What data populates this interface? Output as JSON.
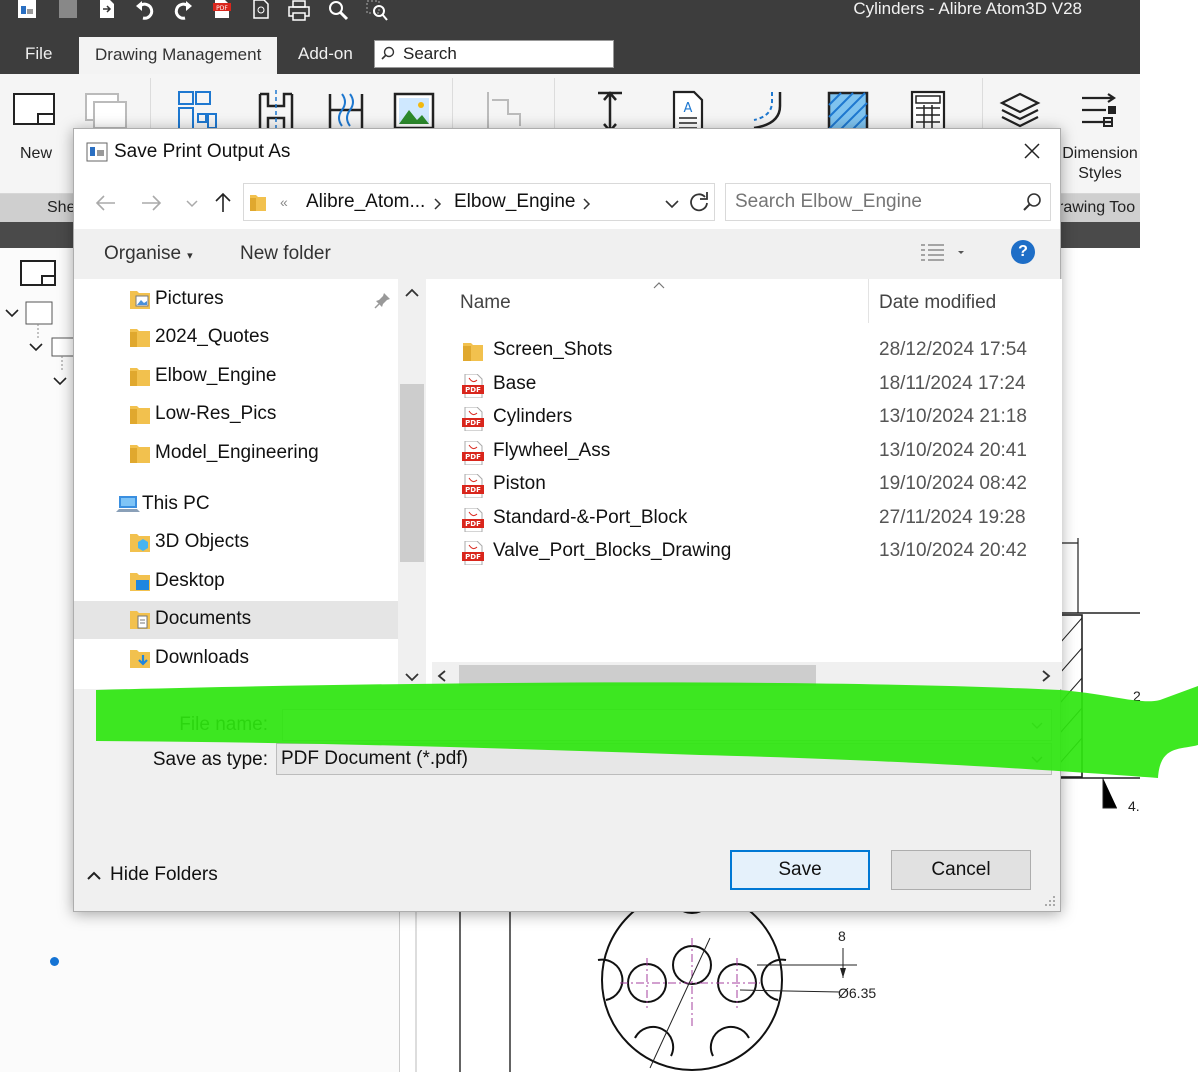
{
  "app": {
    "title": "Cylinders - Alibre Atom3D V28",
    "menu": [
      "File",
      "Drawing Management",
      "Add-on"
    ],
    "search_label": "Search",
    "ribbon": {
      "new_label": "New",
      "dimension_styles_label": "Dimension Styles",
      "strip_left": "She",
      "strip_right": "rawing Too"
    }
  },
  "drawing": {
    "dim_8": "8",
    "dim_dia": "Ø6.35",
    "dim_4": "4.",
    "dim_2": "2"
  },
  "dialog": {
    "title": "Save Print Output As",
    "breadcrumb": [
      "Alibre_Atom...",
      "Elbow_Engine"
    ],
    "search_placeholder": "Search Elbow_Engine",
    "toolbar": {
      "organise": "Organise",
      "new_folder": "New folder",
      "help": "?"
    },
    "nav_items": [
      {
        "label": "Pictures",
        "icon": "pictures-folder-icon"
      },
      {
        "label": "2024_Quotes",
        "icon": "folder-icon"
      },
      {
        "label": "Elbow_Engine",
        "icon": "folder-icon"
      },
      {
        "label": "Low-Res_Pics",
        "icon": "folder-icon"
      },
      {
        "label": "Model_Engineering",
        "icon": "folder-icon"
      },
      {
        "label": "This PC",
        "icon": "this-pc-icon"
      },
      {
        "label": "3D Objects",
        "icon": "3d-objects-icon"
      },
      {
        "label": "Desktop",
        "icon": "desktop-folder-icon"
      },
      {
        "label": "Documents",
        "icon": "documents-folder-icon"
      },
      {
        "label": "Downloads",
        "icon": "downloads-folder-icon"
      }
    ],
    "columns": {
      "name": "Name",
      "date": "Date modified"
    },
    "files": [
      {
        "name": "Screen_Shots",
        "date": "28/12/2024 17:54",
        "type": "folder"
      },
      {
        "name": "Base",
        "date": "18/11/2024 17:24",
        "type": "pdf"
      },
      {
        "name": "Cylinders",
        "date": "13/10/2024 21:18",
        "type": "pdf"
      },
      {
        "name": "Flywheel_Ass",
        "date": "13/10/2024 20:41",
        "type": "pdf"
      },
      {
        "name": "Piston",
        "date": "19/10/2024 08:42",
        "type": "pdf"
      },
      {
        "name": "Standard-&-Port_Block",
        "date": "27/11/2024 19:28",
        "type": "pdf"
      },
      {
        "name": "Valve_Port_Blocks_Drawing",
        "date": "13/10/2024 20:42",
        "type": "pdf"
      }
    ],
    "file_name_label": "File name:",
    "file_name_value": "",
    "save_type_label": "Save as type:",
    "save_type_value": "PDF Document (*.pdf)",
    "hide_folders": "Hide Folders",
    "save_button": "Save",
    "cancel_button": "Cancel"
  },
  "colors": {
    "accent": "#0078d4",
    "highlighter": "#2ee60f",
    "pdf_red": "#d9261c",
    "folder_yellow": "#f2c14e",
    "app_dark": "#3d3d3d"
  }
}
